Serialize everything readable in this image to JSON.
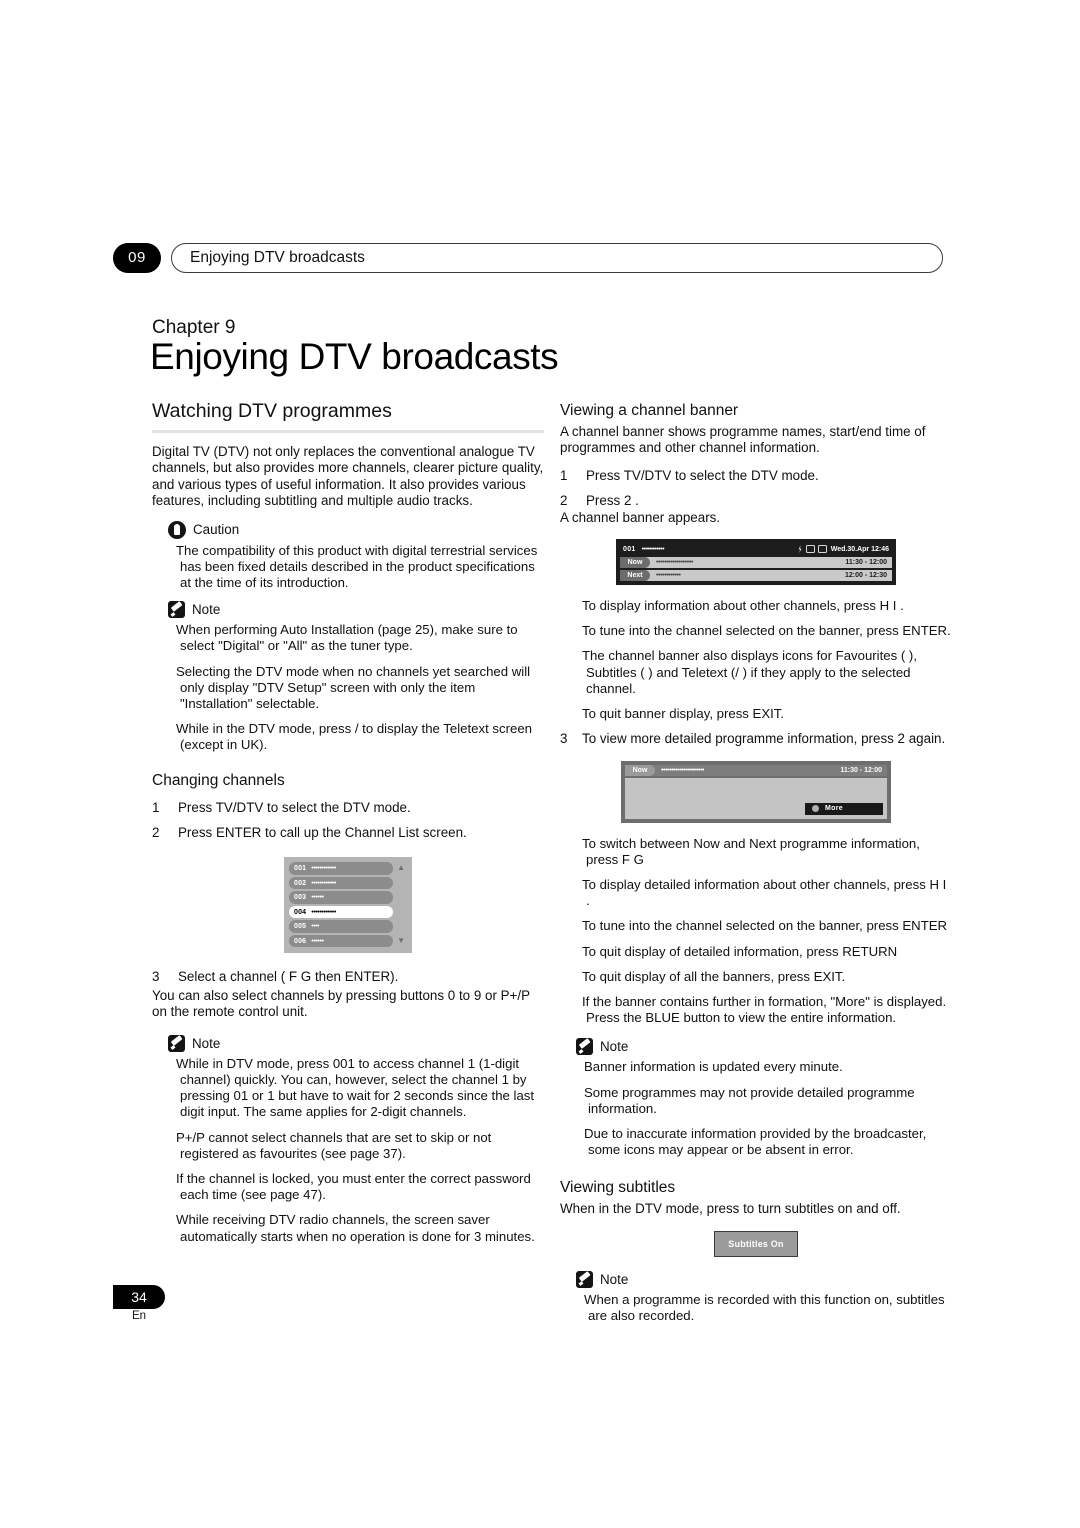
{
  "header": {
    "chapter_number": "09",
    "running_title": "Enjoying DTV broadcasts"
  },
  "title_block": {
    "kicker": "Chapter 9",
    "title": "Enjoying DTV broadcasts"
  },
  "left_column": {
    "section_heading": "Watching DTV programmes",
    "intro": "Digital TV (DTV) not only replaces the conventional analogue TV channels, but also provides more channels, clearer picture quality, and various types of useful information. It also provides various features, including subtitling and multiple audio tracks.",
    "caution": {
      "label": "Caution",
      "icon": "caution-icon",
      "items": [
        "The compatibility of this product with digital terrestrial services has been fixed  details described in the product specifications at the time of its introduction."
      ]
    },
    "note": {
      "label": "Note",
      "icon": "note-pencil-icon",
      "items": [
        "When performing Auto  Installation (page 25), make sure to select \"Digital\" or \"All\" as the tuner type.",
        "Selecting the DTV mode when no channels yet searched will only display \"DTV Setup\" screen with only the item \"Installation\" selectable.",
        "While in the DTV mode, press /  to display the Teletext screen (except in UK)."
      ]
    },
    "changing_channels": {
      "heading": "Changing channels",
      "steps": [
        {
          "num": "1",
          "text": "Press TV/DTV to select the DTV mode."
        },
        {
          "num": "2",
          "text": "Press ENTER to call up the Channel List screen."
        }
      ],
      "step3": {
        "num": "3",
        "text": "Select a channel ( F  G then ENTER).",
        "continuation": "You can also select channels by pressing buttons 0 to 9 or P+/P  on the remote control unit."
      },
      "channel_list": {
        "rows": [
          {
            "number": "001",
            "name_dots": "••••••••••••",
            "selected": false
          },
          {
            "number": "002",
            "name_dots": "••••••••••••",
            "selected": false
          },
          {
            "number": "003",
            "name_dots": "••••••",
            "selected": false
          },
          {
            "number": "004",
            "name_dots": "••••••••••••",
            "selected": true
          },
          {
            "number": "005",
            "name_dots": "••••",
            "selected": false
          },
          {
            "number": "006",
            "name_dots": "••••••",
            "selected": false
          }
        ],
        "scroll_up": "▲",
        "scroll_down": "▼"
      },
      "note": {
        "label": "Note",
        "icon": "note-pencil-icon",
        "items": [
          "While in DTV mode, press 001 to access channel 1 (1-digit channel) quickly. You can, however, select the channel 1 by pressing 01 or 1 but have to wait for 2 seconds since the last digit input. The same applies for 2-digit channels.",
          "P+/P  cannot select channels that are set to skip or not registered as favourites (see page 37).",
          "If the channel is locked, you must enter the correct password each time (see page 47).",
          "While receiving DTV radio channels, the screen saver automatically starts when no operation is done for 3 minutes."
        ]
      }
    }
  },
  "right_column": {
    "viewing_banner": {
      "heading": "Viewing a channel banner",
      "intro": "A channel banner shows programme names, start/end time of programmes and other channel information.",
      "steps": [
        {
          "num": "1",
          "text": "Press TV/DTV to select the DTV mode."
        },
        {
          "num": "2",
          "text": "Press 2 ."
        }
      ],
      "step2_continuation": "A channel banner appears.",
      "banner": {
        "channel_number": "001",
        "channel_dots": "•••••••••••",
        "icons": [
          "favourite-icon",
          "subtitle-icon",
          "teletext-icon"
        ],
        "datetime": "Wed.30.Apr 12:46",
        "rows": [
          {
            "tag": "Now",
            "dots": "••••••••••••••••••",
            "time": "11:30 - 12:00"
          },
          {
            "tag": "Next",
            "dots": "••••••••••••",
            "time": "12:00 - 12:30"
          }
        ]
      },
      "bullets": [
        "To display information about other channels, press  H  I .",
        "To tune into the channel selected on the banner, press ENTER.",
        "The channel banner also displays icons for Favourites (  ), Subtitles (   ) and Teletext (/   ) if they apply to the selected channel.",
        "To quit banner display, press EXIT."
      ],
      "step3": {
        "num": "3",
        "text": "To view more detailed programme information, press       2 again."
      },
      "detail_banner": {
        "tag": "Now",
        "dots": "•••••••••••••••••••••",
        "time": "11:30 - 12:00",
        "more_label": "More"
      },
      "bullets2": [
        "To switch between Now and Next programme information, press  F  G",
        "To display detailed information about other channels, press  H  I .",
        "To tune into the channel selected on the banner, press ENTER",
        "To quit display of detailed information, press RETURN",
        "To quit display of all the banners, press EXIT.",
        "If the banner contains further in formation, \"More\" is displayed. Press the BLUE button to view the entire information."
      ],
      "note": {
        "label": "Note",
        "icon": "note-pencil-icon",
        "items": [
          "Banner information is updated every minute.",
          "Some programmes may not provide detailed programme information.",
          "Due to inaccurate information provided by the broadcaster, some icons may appear or be absent in error."
        ]
      }
    },
    "viewing_subtitles": {
      "heading": "Viewing subtitles",
      "intro": "When in the DTV mode, press    to turn subtitles on and off.",
      "button_label": "Subtitles On",
      "note": {
        "label": "Note",
        "icon": "note-pencil-icon",
        "items": [
          "When a programme is recorded with this function on, subtitles are also recorded."
        ]
      }
    }
  },
  "footer": {
    "page_number": "34",
    "language": "En"
  }
}
